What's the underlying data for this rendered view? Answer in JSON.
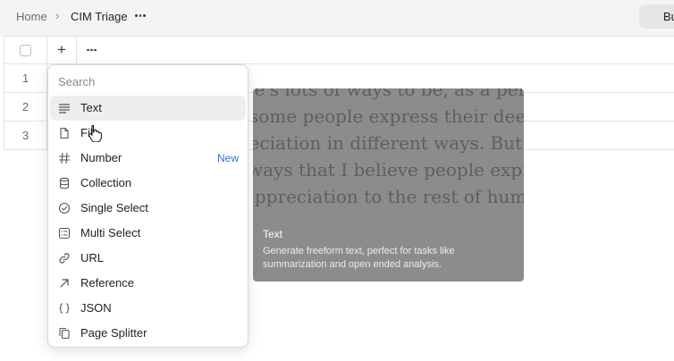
{
  "breadcrumb": {
    "home": "Home",
    "separator": "›",
    "current": "CIM Triage"
  },
  "top_button": {
    "label": "Bu"
  },
  "table": {
    "add_column": "+",
    "rows": [
      "1",
      "2",
      "3"
    ]
  },
  "dropdown": {
    "search_placeholder": "Search",
    "items": [
      {
        "label": "Text",
        "icon": "text-lines-icon"
      },
      {
        "label": "File",
        "icon": "file-icon"
      },
      {
        "label": "Number",
        "icon": "hash-icon",
        "badge": "New"
      },
      {
        "label": "Collection",
        "icon": "database-icon"
      },
      {
        "label": "Single Select",
        "icon": "check-circle-icon"
      },
      {
        "label": "Multi Select",
        "icon": "multi-select-icon"
      },
      {
        "label": "URL",
        "icon": "link-icon"
      },
      {
        "label": "Reference",
        "icon": "arrow-up-right-icon"
      },
      {
        "label": "JSON",
        "icon": "braces-icon"
      },
      {
        "label": "Page Splitter",
        "icon": "copy-pages-icon"
      }
    ]
  },
  "preview": {
    "art_lines": [
      "re's lots of ways to be, as a person",
      "some people express their deep",
      "reciation in different ways. But o",
      "ways that I believe people expres",
      "appreciation to the rest of hum"
    ],
    "title": "Text",
    "description": "Generate freeform text, perfect for tasks like summarization and open ended analysis."
  },
  "colors": {
    "accent": "#3b6fd6",
    "topbar": "#f4f4f5",
    "preview_bg": "#8c8c8c"
  }
}
